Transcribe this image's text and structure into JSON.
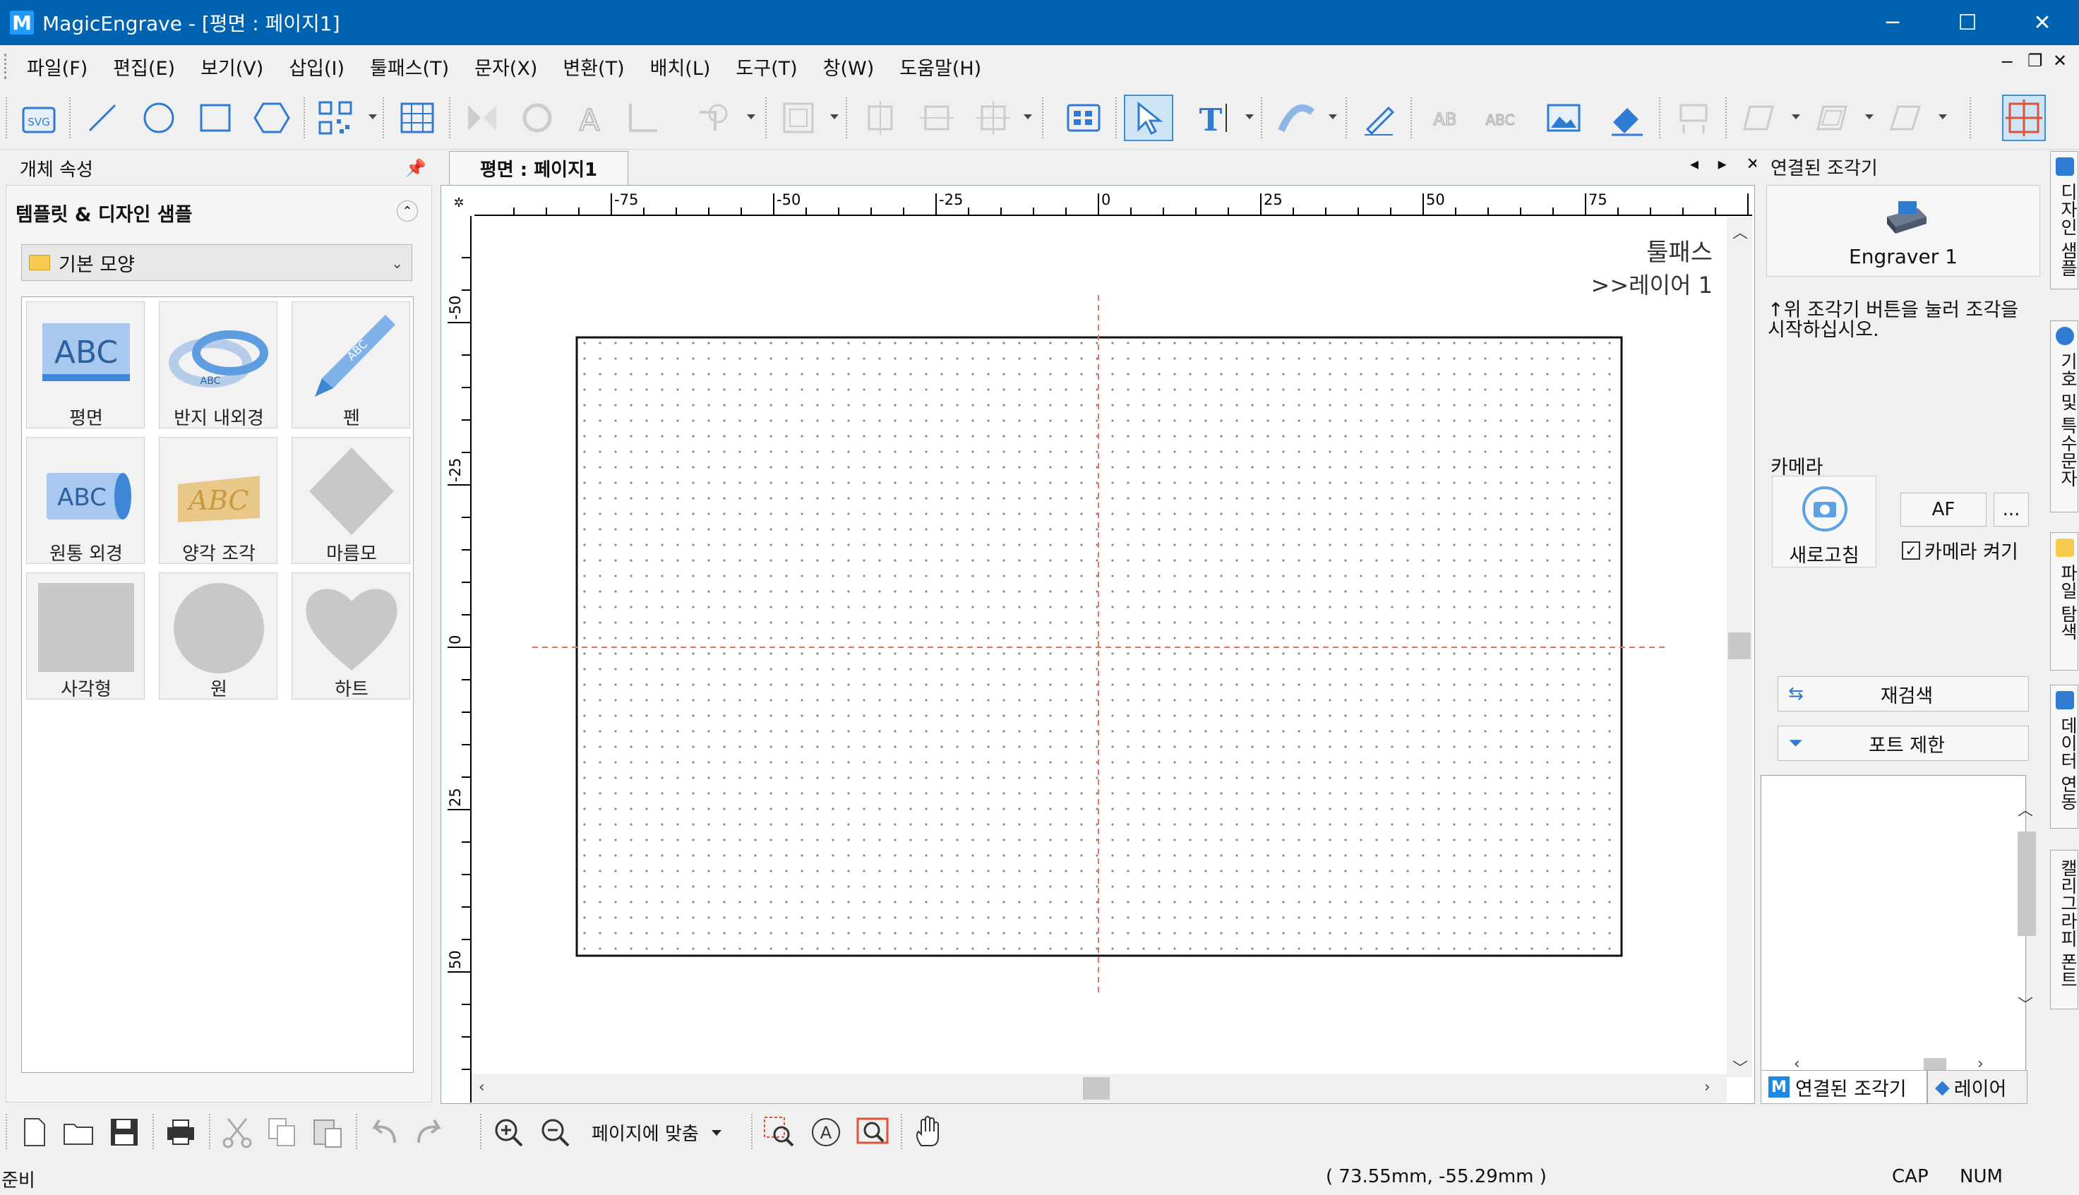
{
  "window": {
    "app_icon": "M",
    "title": "MagicEngrave - [평면 : 페이지1]",
    "controls": {
      "minimize": "─",
      "maximize": "☐",
      "close": "✕"
    }
  },
  "menu": {
    "items": [
      "파일(F)",
      "편집(E)",
      "보기(V)",
      "삽입(I)",
      "툴패스(T)",
      "문자(X)",
      "변환(T)",
      "배치(L)",
      "도구(T)",
      "창(W)",
      "도움말(H)"
    ],
    "mdi_controls": [
      "─",
      "❐",
      "✕"
    ]
  },
  "toolbar": {
    "svg_label": "SVG",
    "ab_label": "AB",
    "abc_label": "ABC"
  },
  "left_panel": {
    "header": "개체 속성",
    "pin": "📌",
    "section_title": "템플릿 & 디자인 샘플",
    "collapse": "⌃",
    "combo_value": "기본 모양",
    "tiles": [
      {
        "label": "평면",
        "art": "ABC"
      },
      {
        "label": "반지 내외경",
        "art": "ABC"
      },
      {
        "label": "펜",
        "art": "ABC"
      },
      {
        "label": "원통 외경",
        "art": "ABC"
      },
      {
        "label": "양각 조각",
        "art": "ABC"
      },
      {
        "label": "마름모"
      },
      {
        "label": "사각형"
      },
      {
        "label": "원"
      },
      {
        "label": "하트"
      }
    ]
  },
  "document": {
    "tab_label": "평면 : 페이지1",
    "tab_controls": "◂ ▸ ✕",
    "ruler_corner": "✲",
    "h_ruler_labels": [
      "-75",
      "-50",
      "-25",
      "0",
      "25",
      "50",
      "75",
      "1"
    ],
    "v_ruler_labels": [
      "-50",
      "-25",
      "0",
      "25",
      "50"
    ],
    "toolpath_line1": "툴패스",
    "toolpath_line2": ">>레이어 1"
  },
  "right_panel": {
    "header": "연결된 조각기",
    "engraver_label": "Engraver 1",
    "hint": "↑위 조각기 버튼을 눌러 조각을 시작하십시오.",
    "camera_title": "카메라",
    "refresh_label": "새로고침",
    "af_label": "AF",
    "more_label": "...",
    "camera_on_label": "카메라 켜기",
    "camera_on_checked": true,
    "rescan_label": "재검색",
    "port_limit_label": "포트 제한",
    "bottom_tabs": [
      "연결된 조각기",
      "레이어"
    ]
  },
  "side_tabs": [
    "디자인 샘플",
    "기호 및 특수문자",
    "파일 탐색",
    "데이터 연동",
    "캘리그라피 폰트"
  ],
  "bottom_toolbar": {
    "zoom_option": "페이지에 맞춤"
  },
  "status": {
    "text": "준비",
    "coords": "( 73.55mm, -55.29mm )",
    "cap": "CAP",
    "num": "NUM"
  },
  "colors": {
    "titlebar": "#0063b1",
    "accent": "#2f7bd1",
    "guide": "#e8745a"
  }
}
